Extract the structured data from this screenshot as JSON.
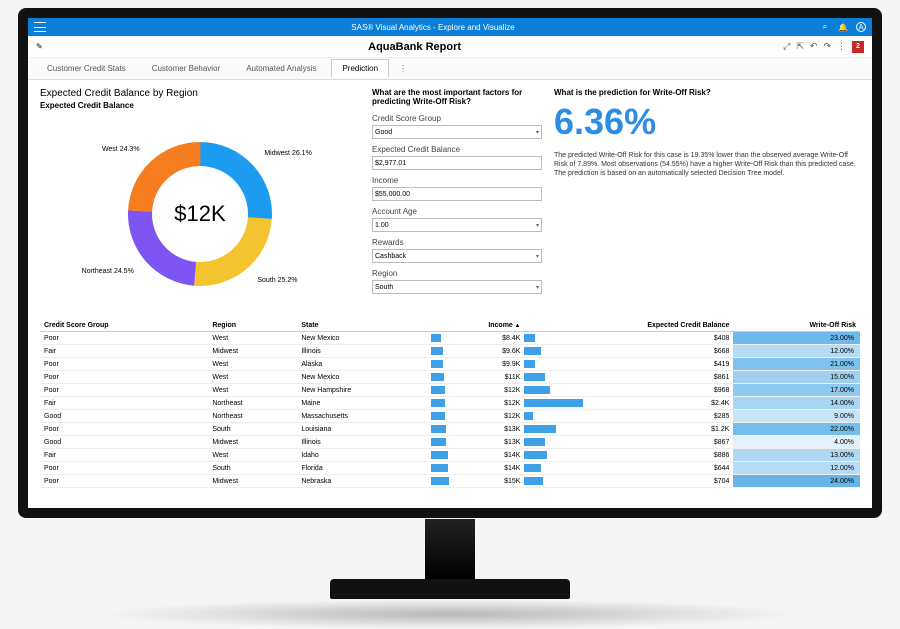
{
  "titlebar": {
    "app_title": "SAS® Visual Analytics - Explore and Visualize",
    "avatar_initial": "A"
  },
  "header": {
    "report_title": "AquaBank Report",
    "badge": "2"
  },
  "tabs": {
    "items": [
      "Customer Credit Stats",
      "Customer Behavior",
      "Automated Analysis",
      "Prediction"
    ],
    "active": 3
  },
  "chart": {
    "title": "Expected Credit Balance by Region",
    "subtitle": "Expected Credit Balance",
    "center_value": "$12K"
  },
  "chart_data": {
    "type": "pie",
    "title": "Expected Credit Balance by Region",
    "slices": [
      {
        "label": "Midwest",
        "value": 26.1,
        "color": "#1d9bf0"
      },
      {
        "label": "South",
        "value": 25.2,
        "color": "#f4c430"
      },
      {
        "label": "Northeast",
        "value": 24.5,
        "color": "#7c55f2"
      },
      {
        "label": "West",
        "value": 24.3,
        "color": "#f57c1f"
      }
    ],
    "center": "$12K",
    "donut": true
  },
  "factors": {
    "question": "What are the most important factors for predicting Write-Off Risk?",
    "fields": [
      {
        "label": "Credit Score Group",
        "value": "Good",
        "type": "select"
      },
      {
        "label": "Expected Credit Balance",
        "value": "$2,977.01",
        "type": "text"
      },
      {
        "label": "Income",
        "value": "$55,000.00",
        "type": "text"
      },
      {
        "label": "Account Age",
        "value": "1.00",
        "type": "select"
      },
      {
        "label": "Rewards",
        "value": "Cashback",
        "type": "select"
      },
      {
        "label": "Region",
        "value": "South",
        "type": "select"
      }
    ]
  },
  "prediction": {
    "question": "What is the prediction for Write-Off Risk?",
    "value": "6.36%",
    "description": "The predicted Write-Off Risk for this case is 19.35% lower than the observed average Write-Off Risk of 7.89%. Most observations (54.55%) have a higher Write-Off Risk than this predicted case. The prediction is based on an automatically selected Decision Tree model."
  },
  "table": {
    "columns": [
      "Credit Score Group",
      "Region",
      "State",
      "Income",
      "Expected Credit Balance",
      "Write-Off Risk"
    ],
    "sort_col": 3,
    "rows": [
      {
        "csg": "Poor",
        "region": "West",
        "state": "New Mexico",
        "income": "$8.4K",
        "income_w": 10,
        "ecb": "$408",
        "ecb_w": 5,
        "risk": "23.00%",
        "risk_w": 92,
        "risk_c": "#6fb8ea"
      },
      {
        "csg": "Fair",
        "region": "Midwest",
        "state": "Illinois",
        "income": "$9.6K",
        "income_w": 12,
        "ecb": "$668",
        "ecb_w": 8,
        "risk": "12.00%",
        "risk_w": 48,
        "risk_c": "#b6dcf5"
      },
      {
        "csg": "Poor",
        "region": "West",
        "state": "Alaska",
        "income": "$9.9K",
        "income_w": 12,
        "ecb": "$419",
        "ecb_w": 5,
        "risk": "21.00%",
        "risk_w": 84,
        "risk_c": "#7ec1ed"
      },
      {
        "csg": "Poor",
        "region": "West",
        "state": "New Mexico",
        "income": "$11K",
        "income_w": 14,
        "ecb": "$861",
        "ecb_w": 10,
        "risk": "15.00%",
        "risk_w": 60,
        "risk_c": "#9fd0f0"
      },
      {
        "csg": "Poor",
        "region": "West",
        "state": "New Hampshire",
        "income": "$12K",
        "income_w": 15,
        "ecb": "$968",
        "ecb_w": 12,
        "risk": "17.00%",
        "risk_w": 68,
        "risk_c": "#90c9ef"
      },
      {
        "csg": "Fair",
        "region": "Northeast",
        "state": "Maine",
        "income": "$12K",
        "income_w": 15,
        "ecb": "$2.4K",
        "ecb_w": 28,
        "risk": "14.00%",
        "risk_w": 56,
        "risk_c": "#a8d5f2"
      },
      {
        "csg": "Good",
        "region": "Northeast",
        "state": "Massachusetts",
        "income": "$12K",
        "income_w": 15,
        "ecb": "$285",
        "ecb_w": 4,
        "risk": "9.00%",
        "risk_w": 36,
        "risk_c": "#c8e4f7"
      },
      {
        "csg": "Poor",
        "region": "South",
        "state": "Louisiana",
        "income": "$13K",
        "income_w": 16,
        "ecb": "$1.2K",
        "ecb_w": 15,
        "risk": "22.00%",
        "risk_w": 88,
        "risk_c": "#76bdec"
      },
      {
        "csg": "Good",
        "region": "Midwest",
        "state": "Illinois",
        "income": "$13K",
        "income_w": 16,
        "ecb": "$867",
        "ecb_w": 10,
        "risk": "4.00%",
        "risk_w": 16,
        "risk_c": "#e3f1fb"
      },
      {
        "csg": "Fair",
        "region": "West",
        "state": "Idaho",
        "income": "$14K",
        "income_w": 18,
        "ecb": "$886",
        "ecb_w": 11,
        "risk": "13.00%",
        "risk_w": 52,
        "risk_c": "#afd8f3"
      },
      {
        "csg": "Poor",
        "region": "South",
        "state": "Florida",
        "income": "$14K",
        "income_w": 18,
        "ecb": "$644",
        "ecb_w": 8,
        "risk": "12.00%",
        "risk_w": 48,
        "risk_c": "#b6dcf5"
      },
      {
        "csg": "Poor",
        "region": "Midwest",
        "state": "Nebraska",
        "income": "$15K",
        "income_w": 19,
        "ecb": "$704",
        "ecb_w": 9,
        "risk": "24.00%",
        "risk_w": 96,
        "risk_c": "#67b4e9"
      }
    ]
  }
}
